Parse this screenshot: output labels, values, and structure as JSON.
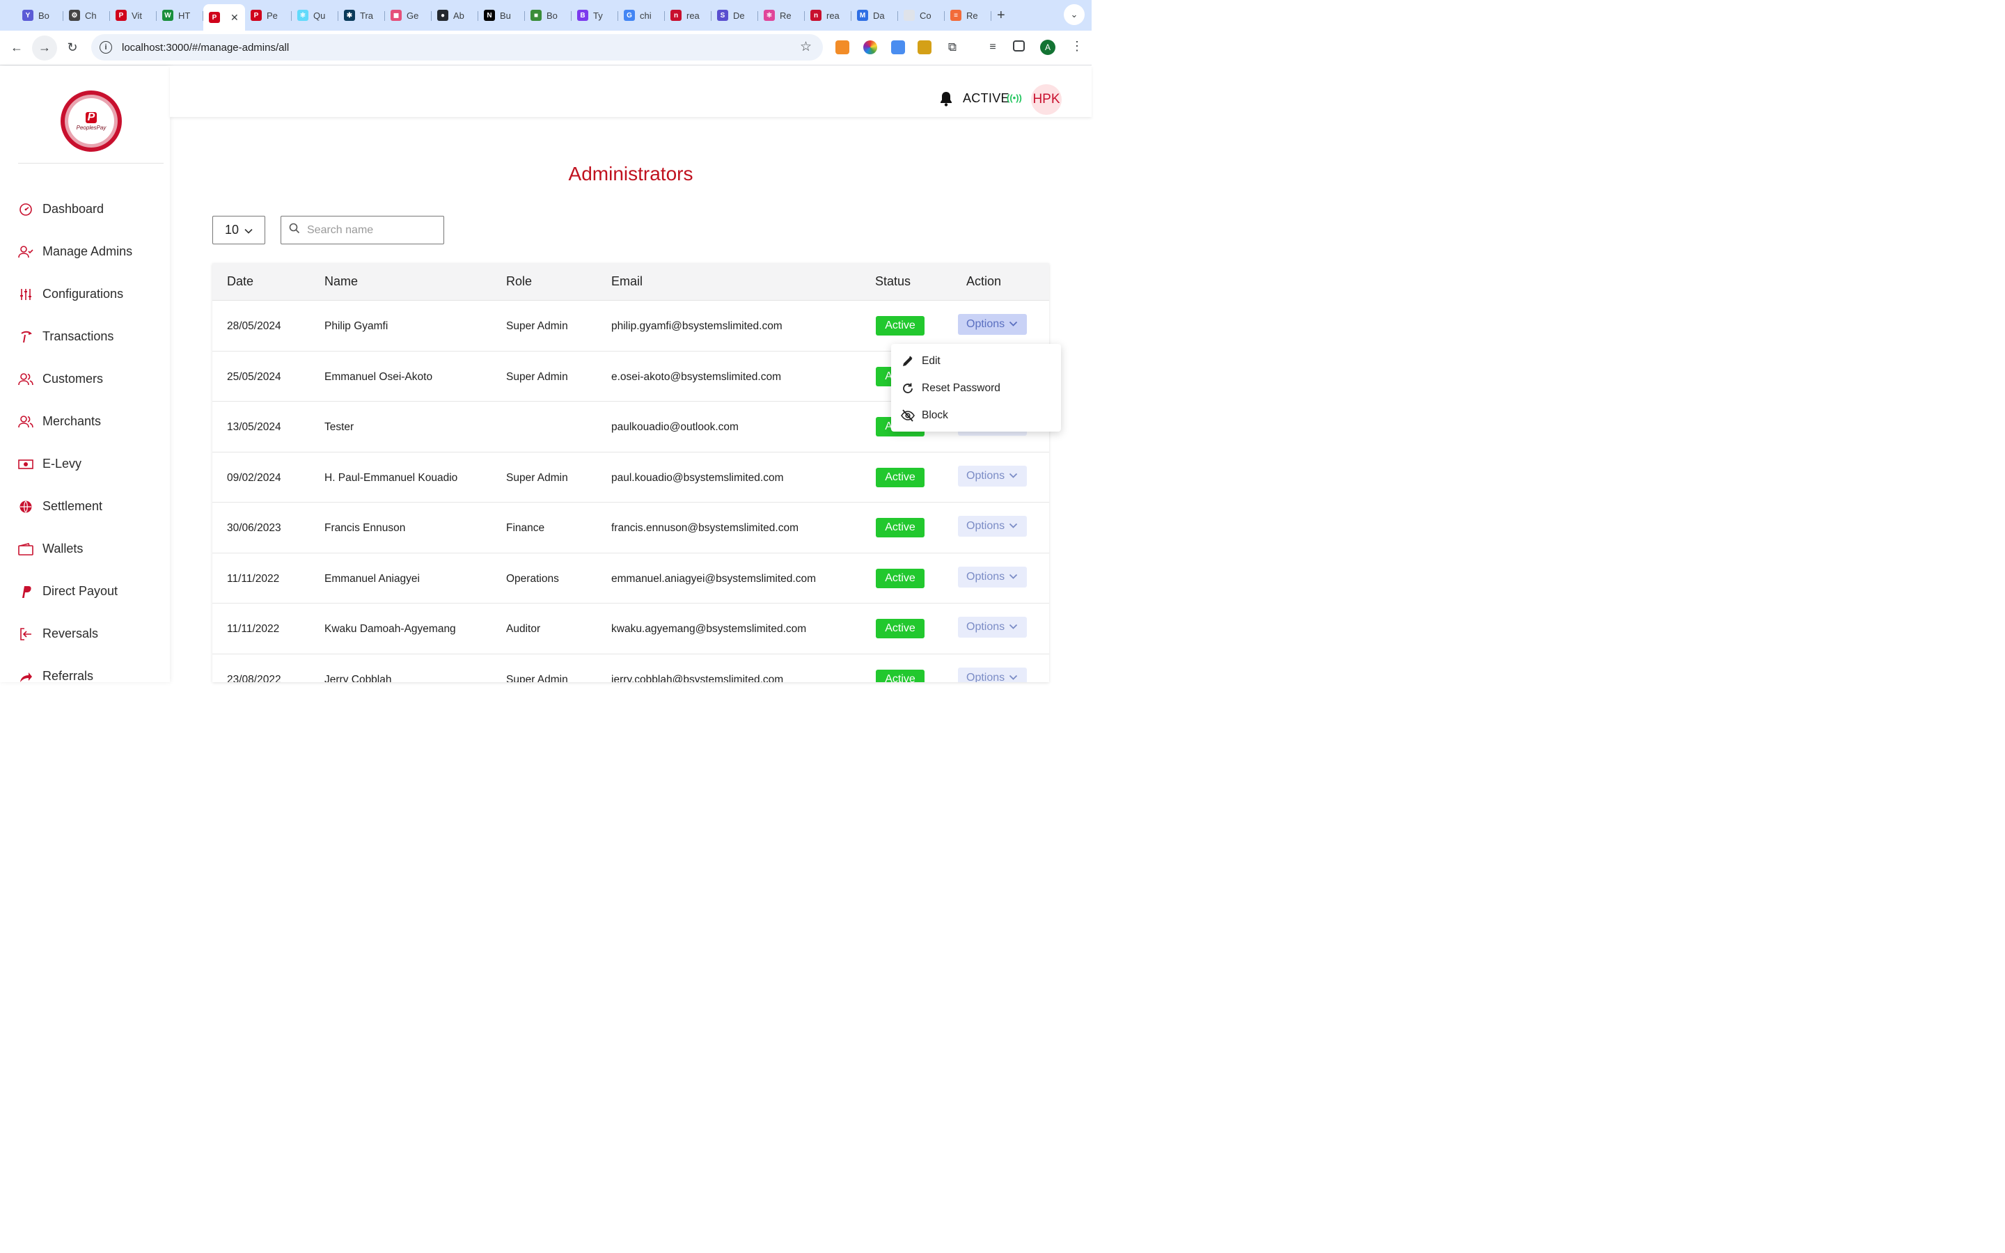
{
  "browser": {
    "tabs": [
      {
        "label": "Bo",
        "fav_color": "#5b5bd6",
        "fav_glyph": "Y"
      },
      {
        "label": "Ch",
        "fav_color": "#444444",
        "fav_glyph": "⚙"
      },
      {
        "label": "Vit",
        "fav_color": "#d0021b",
        "fav_glyph": "P"
      },
      {
        "label": "HT",
        "fav_color": "#1a8f3c",
        "fav_glyph": "W"
      },
      {
        "label": "",
        "fav_color": "#d0021b",
        "fav_glyph": "P",
        "active": true
      },
      {
        "label": "Pe",
        "fav_color": "#d0021b",
        "fav_glyph": "P"
      },
      {
        "label": "Qu",
        "fav_color": "#61dafb",
        "fav_glyph": "⚛"
      },
      {
        "label": "Tra",
        "fav_color": "#0b3b5b",
        "fav_glyph": "✱"
      },
      {
        "label": "Ge",
        "fav_color": "#e5507a",
        "fav_glyph": "◼"
      },
      {
        "label": "Ab",
        "fav_color": "#24292f",
        "fav_glyph": "●"
      },
      {
        "label": "Bu",
        "fav_color": "#000000",
        "fav_glyph": "N"
      },
      {
        "label": "Bo",
        "fav_color": "#3a8d3a",
        "fav_glyph": "■"
      },
      {
        "label": "Ty",
        "fav_color": "#7c3aed",
        "fav_glyph": "B"
      },
      {
        "label": "chi",
        "fav_color": "#4285f4",
        "fav_glyph": "G"
      },
      {
        "label": "rea",
        "fav_color": "#c8102e",
        "fav_glyph": "n"
      },
      {
        "label": "De",
        "fav_color": "#5a4fcf",
        "fav_glyph": "S"
      },
      {
        "label": "Re",
        "fav_color": "#e0469a",
        "fav_glyph": "⚛"
      },
      {
        "label": "rea",
        "fav_color": "#c8102e",
        "fav_glyph": "n"
      },
      {
        "label": "Da",
        "fav_color": "#2f6fe4",
        "fav_glyph": "M"
      },
      {
        "label": "Co",
        "fav_color": "#dfe3ea",
        "fav_glyph": ""
      },
      {
        "label": "Re",
        "fav_color": "#f26b3a",
        "fav_glyph": "≡"
      }
    ],
    "new_tab_label": "+",
    "url": "localhost:3000/#/manage-admins/all",
    "profile_initial": "A"
  },
  "sidebar": {
    "logo_text": "PeoplesPay",
    "items": [
      {
        "label": "Dashboard",
        "icon": "gauge-icon"
      },
      {
        "label": "Manage Admins",
        "icon": "user-check-icon"
      },
      {
        "label": "Configurations",
        "icon": "sliders-icon"
      },
      {
        "label": "Transactions",
        "icon": "transaction-icon"
      },
      {
        "label": "Customers",
        "icon": "users-icon"
      },
      {
        "label": "Merchants",
        "icon": "users-icon"
      },
      {
        "label": "E-Levy",
        "icon": "money-icon"
      },
      {
        "label": "Settlement",
        "icon": "globe-icon"
      },
      {
        "label": "Wallets",
        "icon": "wallet-icon"
      },
      {
        "label": "Direct Payout",
        "icon": "paypal-icon"
      },
      {
        "label": "Reversals",
        "icon": "reverse-icon"
      },
      {
        "label": "Referrals",
        "icon": "share-icon"
      }
    ],
    "accent": "#c8102e"
  },
  "header": {
    "status": "ACTIVE",
    "avatar_initials": "HPK"
  },
  "page": {
    "title": "Administrators",
    "page_size": "10",
    "search_placeholder": "Search name"
  },
  "table": {
    "columns": [
      "Date",
      "Name",
      "Role",
      "Email",
      "Status",
      "Action"
    ],
    "rows": [
      {
        "date": "28/05/2024",
        "name": "Philip Gyamfi",
        "role": "Super Admin",
        "email": "philip.gyamfi@bsystemslimited.com",
        "status": "Active",
        "action": "Options"
      },
      {
        "date": "25/05/2024",
        "name": "Emmanuel Osei-Akoto",
        "role": "Super Admin",
        "email": "e.osei-akoto@bsystemslimited.com",
        "status": "Active",
        "action": "Options"
      },
      {
        "date": "13/05/2024",
        "name": "Tester",
        "role": "",
        "email": "paulkouadio@outlook.com",
        "status": "Active",
        "action": "Options"
      },
      {
        "date": "09/02/2024",
        "name": "H. Paul-Emmanuel Kouadio",
        "role": "Super Admin",
        "email": "paul.kouadio@bsystemslimited.com",
        "status": "Active",
        "action": "Options"
      },
      {
        "date": "30/06/2023",
        "name": "Francis Ennuson",
        "role": "Finance",
        "email": "francis.ennuson@bsystemslimited.com",
        "status": "Active",
        "action": "Options"
      },
      {
        "date": "11/11/2022",
        "name": "Emmanuel Aniagyei",
        "role": "Operations",
        "email": "emmanuel.aniagyei@bsystemslimited.com",
        "status": "Active",
        "action": "Options"
      },
      {
        "date": "11/11/2022",
        "name": "Kwaku Damoah-Agyemang",
        "role": "Auditor",
        "email": "kwaku.agyemang@bsystemslimited.com",
        "status": "Active",
        "action": "Options"
      },
      {
        "date": "23/08/2022",
        "name": "Jerry Cobblah",
        "role": "Super Admin",
        "email": "jerry.cobblah@bsystemslimited.com",
        "status": "Active",
        "action": "Options"
      }
    ],
    "status_color": "#22c82e"
  },
  "options_menu": {
    "items": [
      {
        "label": "Edit",
        "icon": "pencil-icon"
      },
      {
        "label": "Reset Password",
        "icon": "refresh-icon"
      },
      {
        "label": "Block",
        "icon": "eye-off-icon"
      }
    ]
  }
}
